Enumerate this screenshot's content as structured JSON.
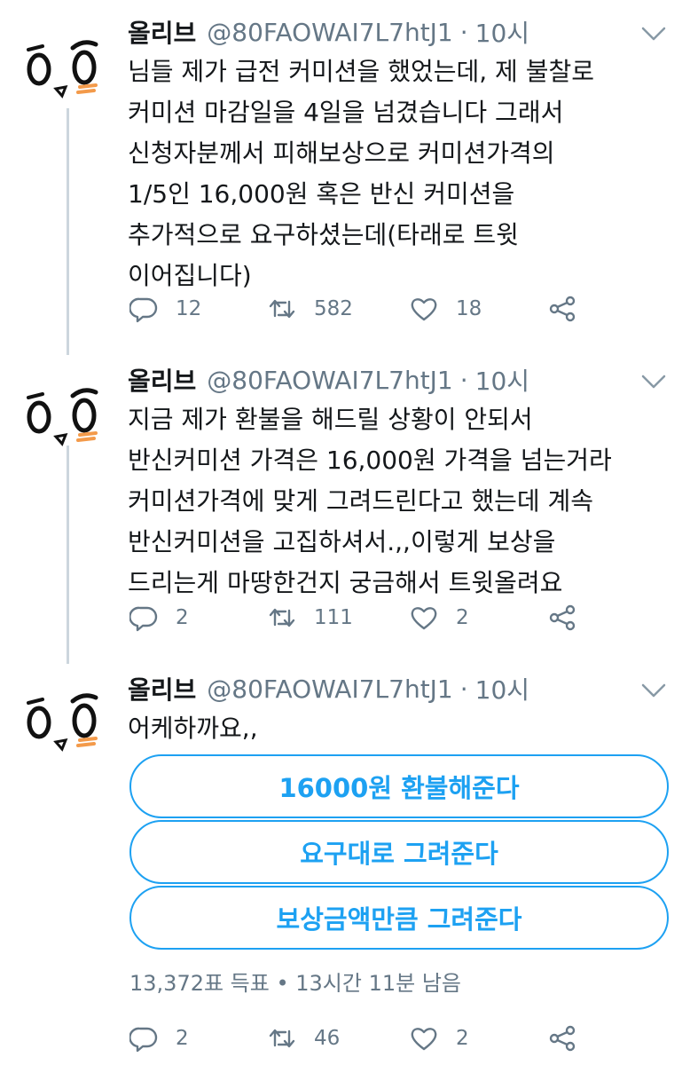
{
  "tweets": [
    {
      "name": "올리브",
      "handle": "@80FAOWAI7L7htJ1",
      "separator": "·",
      "time": "10시",
      "lines": [
        "님들 제가 급전 커미션을 했었는데, 제 불찰로",
        "커미션 마감일을 4일을 넘겼습니다 그래서",
        "신청자분께서 피해보상으로 커미션가격의",
        "1/5인 16,000원 혹은 반신 커미션을",
        "추가적으로 요구하셨는데(타래로 트윗",
        "이어집니다)"
      ],
      "replies": "12",
      "retweets": "582",
      "likes": "18"
    },
    {
      "name": "올리브",
      "handle": "@80FAOWAI7L7htJ1",
      "separator": "·",
      "time": "10시",
      "lines": [
        "지금 제가 환불을 해드릴 상황이 안되서",
        "반신커미션 가격은 16,000원 가격을 넘는거라",
        "커미션가격에 맞게 그려드린다고 했는데 계속",
        "반신커미션을 고집하셔서.,,이렇게 보상을",
        "드리는게 마땅한건지 궁금해서 트윗올려요"
      ],
      "replies": "2",
      "retweets": "111",
      "likes": "2"
    },
    {
      "name": "올리브",
      "handle": "@80FAOWAI7L7htJ1",
      "separator": "·",
      "time": "10시",
      "lines": [
        "어케하까요,,"
      ],
      "poll": {
        "options": [
          "16000원 환불해준다",
          "요구대로 그려준다",
          "보상금액만큼 그려준다"
        ],
        "votes": "13,372표 득표 • 13시간 11분 남음"
      },
      "replies": "2",
      "retweets": "46",
      "likes": "2"
    }
  ],
  "icons": {
    "reply": "reply-icon",
    "retweet": "retweet-icon",
    "like": "heart-icon",
    "share": "share-icon",
    "caret": "chevron-down-icon"
  },
  "colors": {
    "accent": "#1da1f2",
    "muted": "#657786",
    "text": "#14171a",
    "thread_line": "#ccd6dd"
  }
}
